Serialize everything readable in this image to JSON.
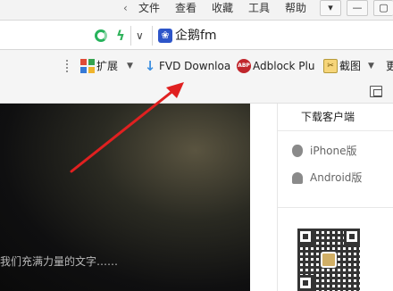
{
  "menubar": {
    "items": [
      "文件",
      "查看",
      "收藏",
      "工具",
      "帮助"
    ]
  },
  "window_controls": {
    "skin_icon": "shirt-icon",
    "minimize_icon": "minimize-icon",
    "maximize_icon": "maximize-icon"
  },
  "address_bar": {
    "text": "企鹅fm",
    "site_icon": "paw-icon"
  },
  "toolbar": {
    "extensions_label": "扩展",
    "fvd_label": "FVD Downloa",
    "adblock_label": "Adblock Plu",
    "screenshot_label": "截图",
    "overflow_label": "更"
  },
  "video": {
    "caption": "我们充满力量的文字……"
  },
  "sidebar": {
    "title": "下载客户端",
    "iphone_label": "iPhone版",
    "android_label": "Android版"
  },
  "colors": {
    "annotation_arrow": "#e02020",
    "refresh_green": "#27b35c",
    "adblock_red": "#c0262c"
  }
}
